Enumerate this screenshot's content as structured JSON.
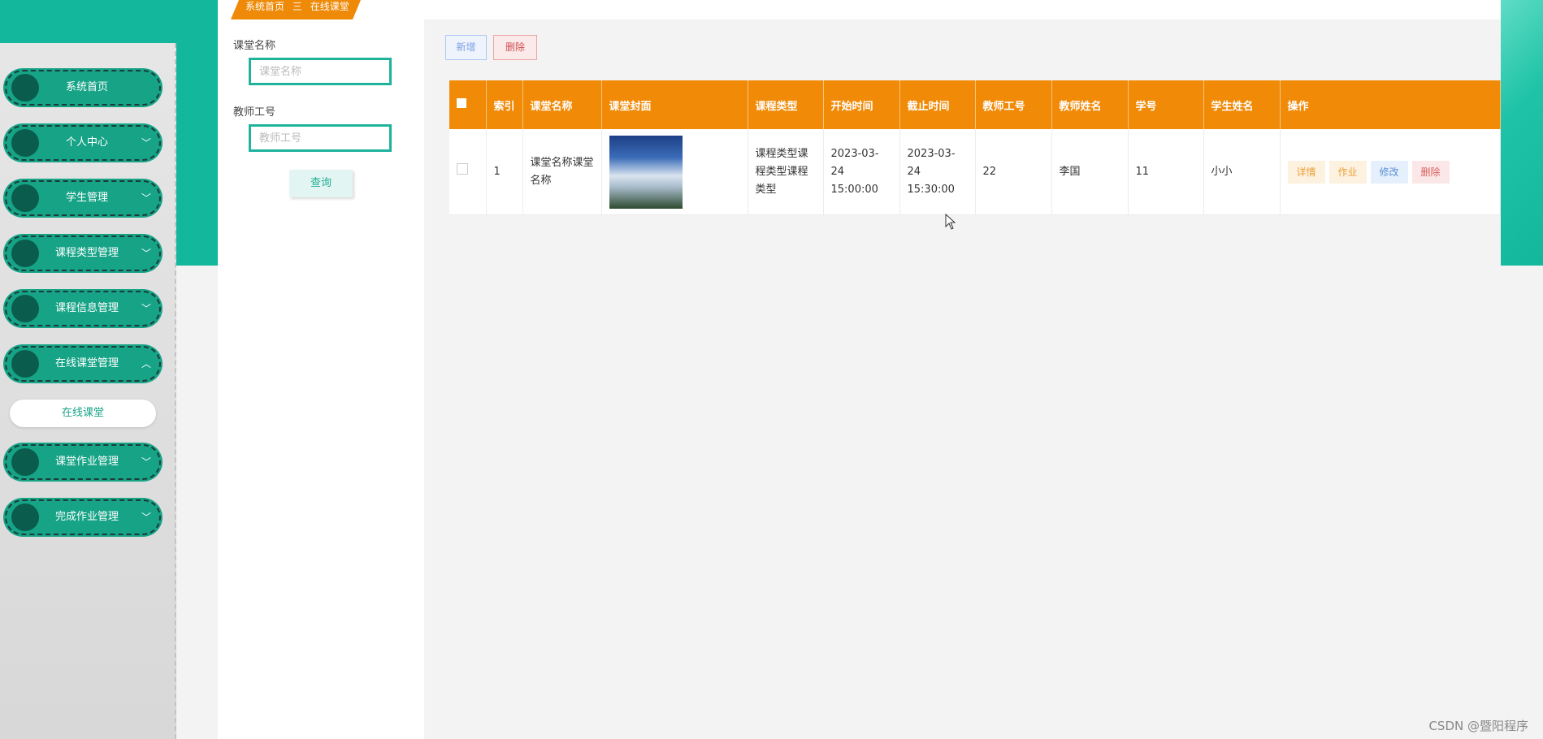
{
  "breadcrumb": {
    "home": "系统首页",
    "sep": "三",
    "current": "在线课堂"
  },
  "sidebar": {
    "items": [
      {
        "label": "系统首页",
        "chevron": ""
      },
      {
        "label": "个人中心",
        "chevron": "﹀"
      },
      {
        "label": "学生管理",
        "chevron": "﹀"
      },
      {
        "label": "课程类型管理",
        "chevron": "﹀"
      },
      {
        "label": "课程信息管理",
        "chevron": "﹀"
      },
      {
        "label": "在线课堂管理",
        "chevron": "︿"
      },
      {
        "label": "课堂作业管理",
        "chevron": "﹀"
      },
      {
        "label": "完成作业管理",
        "chevron": "﹀"
      }
    ],
    "sub_item": "在线课堂"
  },
  "search": {
    "name_label": "课堂名称",
    "name_placeholder": "课堂名称",
    "teacher_label": "教师工号",
    "teacher_placeholder": "教师工号",
    "query_button": "查询"
  },
  "toolbar": {
    "add": "新增",
    "delete": "删除"
  },
  "table": {
    "headers": [
      "索引",
      "课堂名称",
      "课堂封面",
      "课程类型",
      "开始时间",
      "截止时间",
      "教师工号",
      "教师姓名",
      "学号",
      "学生姓名",
      "操作"
    ],
    "rows": [
      {
        "index": "1",
        "name": "课堂名称课堂名称",
        "type": "课程类型课程类型课程类型",
        "start": "2023-03-24 15:00:00",
        "end": "2023-03-24 15:30:00",
        "teacher_id": "22",
        "teacher_name": "李国",
        "student_id": "11",
        "student_name": "小小",
        "actions": {
          "detail": "详情",
          "homework": "作业",
          "edit": "修改",
          "delete": "删除"
        }
      }
    ]
  },
  "watermark": "CSDN @暨阳程序",
  "colors": {
    "accent": "#12b79c",
    "header": "#f08a07"
  }
}
